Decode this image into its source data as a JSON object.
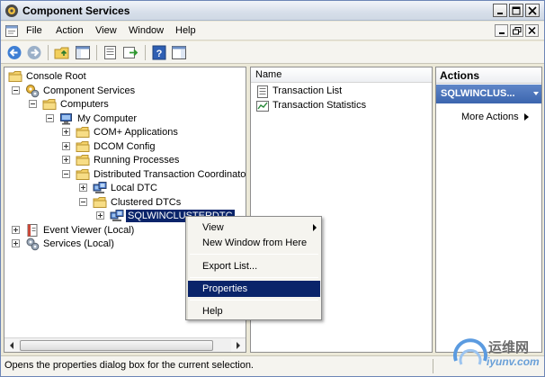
{
  "window": {
    "title": "Component Services",
    "title_icon": "component-services-icon"
  },
  "menu": {
    "items": [
      "File",
      "Action",
      "View",
      "Window",
      "Help"
    ]
  },
  "toolbar": {
    "buttons": [
      "back-icon",
      "forward-icon",
      "up-level-icon",
      "show-hide-tree-icon",
      "export-list-icon",
      "properties-icon",
      "help-icon",
      "show-hide-action-pane-icon"
    ]
  },
  "tree": {
    "nodes": [
      {
        "label": "Console Root",
        "icon": "folder-icon",
        "expander": "none"
      },
      {
        "label": "Component Services",
        "icon": "component-services-icon",
        "expander": "minus"
      },
      {
        "label": "Computers",
        "icon": "folder-icon",
        "expander": "minus"
      },
      {
        "label": "My Computer",
        "icon": "computer-icon",
        "expander": "minus"
      },
      {
        "label": "COM+ Applications",
        "icon": "folder-icon",
        "expander": "plus"
      },
      {
        "label": "DCOM Config",
        "icon": "folder-icon",
        "expander": "plus"
      },
      {
        "label": "Running Processes",
        "icon": "folder-icon",
        "expander": "plus"
      },
      {
        "label": "Distributed Transaction Coordinator",
        "icon": "folder-icon",
        "expander": "minus"
      },
      {
        "label": "Local DTC",
        "icon": "dtc-icon",
        "expander": "plus"
      },
      {
        "label": "Clustered DTCs",
        "icon": "folder-icon",
        "expander": "minus"
      },
      {
        "label": "SQLWINCLUSTERDTC",
        "icon": "dtc-icon",
        "expander": "plus",
        "selected": true
      },
      {
        "label": "Event Viewer (Local)",
        "icon": "event-viewer-icon",
        "expander": "plus"
      },
      {
        "label": "Services (Local)",
        "icon": "services-icon",
        "expander": "plus"
      }
    ]
  },
  "list": {
    "column_header": "Name",
    "items": [
      {
        "label": "Transaction List",
        "icon": "transaction-list-icon"
      },
      {
        "label": "Transaction Statistics",
        "icon": "transaction-statistics-icon"
      }
    ]
  },
  "actions": {
    "header": "Actions",
    "group": "SQLWINCLUS...",
    "more_actions": "More Actions"
  },
  "context_menu": {
    "items": [
      {
        "label": "View",
        "submenu": true
      },
      {
        "label": "New Window from Here"
      },
      {
        "label": "Export List..."
      },
      {
        "label": "Properties",
        "highlighted": true
      },
      {
        "label": "Help"
      }
    ]
  },
  "status": {
    "text": "Opens the properties dialog box for the current selection."
  },
  "watermark": {
    "top": "运维网",
    "bottom": "iyunv.com"
  },
  "colors": {
    "selection": "#0a246a",
    "actions_group": "#4a72b8"
  }
}
